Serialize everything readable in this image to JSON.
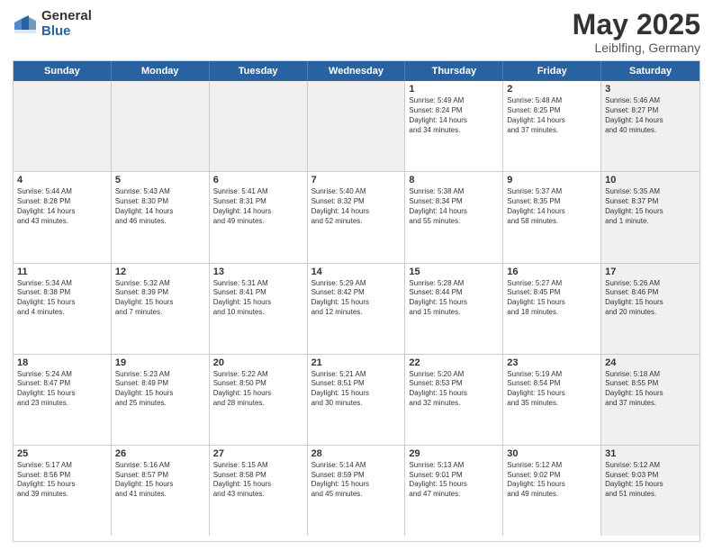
{
  "header": {
    "logo_general": "General",
    "logo_blue": "Blue",
    "title": "May 2025",
    "location": "Leiblfing, Germany"
  },
  "days": [
    "Sunday",
    "Monday",
    "Tuesday",
    "Wednesday",
    "Thursday",
    "Friday",
    "Saturday"
  ],
  "weeks": [
    [
      {
        "day": "",
        "info": "",
        "shaded": true
      },
      {
        "day": "",
        "info": "",
        "shaded": true
      },
      {
        "day": "",
        "info": "",
        "shaded": true
      },
      {
        "day": "",
        "info": "",
        "shaded": true
      },
      {
        "day": "1",
        "info": "Sunrise: 5:49 AM\nSunset: 8:24 PM\nDaylight: 14 hours\nand 34 minutes.",
        "shaded": false
      },
      {
        "day": "2",
        "info": "Sunrise: 5:48 AM\nSunset: 8:25 PM\nDaylight: 14 hours\nand 37 minutes.",
        "shaded": false
      },
      {
        "day": "3",
        "info": "Sunrise: 5:46 AM\nSunset: 8:27 PM\nDaylight: 14 hours\nand 40 minutes.",
        "shaded": true
      }
    ],
    [
      {
        "day": "4",
        "info": "Sunrise: 5:44 AM\nSunset: 8:28 PM\nDaylight: 14 hours\nand 43 minutes.",
        "shaded": false
      },
      {
        "day": "5",
        "info": "Sunrise: 5:43 AM\nSunset: 8:30 PM\nDaylight: 14 hours\nand 46 minutes.",
        "shaded": false
      },
      {
        "day": "6",
        "info": "Sunrise: 5:41 AM\nSunset: 8:31 PM\nDaylight: 14 hours\nand 49 minutes.",
        "shaded": false
      },
      {
        "day": "7",
        "info": "Sunrise: 5:40 AM\nSunset: 8:32 PM\nDaylight: 14 hours\nand 52 minutes.",
        "shaded": false
      },
      {
        "day": "8",
        "info": "Sunrise: 5:38 AM\nSunset: 8:34 PM\nDaylight: 14 hours\nand 55 minutes.",
        "shaded": false
      },
      {
        "day": "9",
        "info": "Sunrise: 5:37 AM\nSunset: 8:35 PM\nDaylight: 14 hours\nand 58 minutes.",
        "shaded": false
      },
      {
        "day": "10",
        "info": "Sunrise: 5:35 AM\nSunset: 8:37 PM\nDaylight: 15 hours\nand 1 minute.",
        "shaded": true
      }
    ],
    [
      {
        "day": "11",
        "info": "Sunrise: 5:34 AM\nSunset: 8:38 PM\nDaylight: 15 hours\nand 4 minutes.",
        "shaded": false
      },
      {
        "day": "12",
        "info": "Sunrise: 5:32 AM\nSunset: 8:39 PM\nDaylight: 15 hours\nand 7 minutes.",
        "shaded": false
      },
      {
        "day": "13",
        "info": "Sunrise: 5:31 AM\nSunset: 8:41 PM\nDaylight: 15 hours\nand 10 minutes.",
        "shaded": false
      },
      {
        "day": "14",
        "info": "Sunrise: 5:29 AM\nSunset: 8:42 PM\nDaylight: 15 hours\nand 12 minutes.",
        "shaded": false
      },
      {
        "day": "15",
        "info": "Sunrise: 5:28 AM\nSunset: 8:44 PM\nDaylight: 15 hours\nand 15 minutes.",
        "shaded": false
      },
      {
        "day": "16",
        "info": "Sunrise: 5:27 AM\nSunset: 8:45 PM\nDaylight: 15 hours\nand 18 minutes.",
        "shaded": false
      },
      {
        "day": "17",
        "info": "Sunrise: 5:26 AM\nSunset: 8:46 PM\nDaylight: 15 hours\nand 20 minutes.",
        "shaded": true
      }
    ],
    [
      {
        "day": "18",
        "info": "Sunrise: 5:24 AM\nSunset: 8:47 PM\nDaylight: 15 hours\nand 23 minutes.",
        "shaded": false
      },
      {
        "day": "19",
        "info": "Sunrise: 5:23 AM\nSunset: 8:49 PM\nDaylight: 15 hours\nand 25 minutes.",
        "shaded": false
      },
      {
        "day": "20",
        "info": "Sunrise: 5:22 AM\nSunset: 8:50 PM\nDaylight: 15 hours\nand 28 minutes.",
        "shaded": false
      },
      {
        "day": "21",
        "info": "Sunrise: 5:21 AM\nSunset: 8:51 PM\nDaylight: 15 hours\nand 30 minutes.",
        "shaded": false
      },
      {
        "day": "22",
        "info": "Sunrise: 5:20 AM\nSunset: 8:53 PM\nDaylight: 15 hours\nand 32 minutes.",
        "shaded": false
      },
      {
        "day": "23",
        "info": "Sunrise: 5:19 AM\nSunset: 8:54 PM\nDaylight: 15 hours\nand 35 minutes.",
        "shaded": false
      },
      {
        "day": "24",
        "info": "Sunrise: 5:18 AM\nSunset: 8:55 PM\nDaylight: 15 hours\nand 37 minutes.",
        "shaded": true
      }
    ],
    [
      {
        "day": "25",
        "info": "Sunrise: 5:17 AM\nSunset: 8:56 PM\nDaylight: 15 hours\nand 39 minutes.",
        "shaded": false
      },
      {
        "day": "26",
        "info": "Sunrise: 5:16 AM\nSunset: 8:57 PM\nDaylight: 15 hours\nand 41 minutes.",
        "shaded": false
      },
      {
        "day": "27",
        "info": "Sunrise: 5:15 AM\nSunset: 8:58 PM\nDaylight: 15 hours\nand 43 minutes.",
        "shaded": false
      },
      {
        "day": "28",
        "info": "Sunrise: 5:14 AM\nSunset: 8:59 PM\nDaylight: 15 hours\nand 45 minutes.",
        "shaded": false
      },
      {
        "day": "29",
        "info": "Sunrise: 5:13 AM\nSunset: 9:01 PM\nDaylight: 15 hours\nand 47 minutes.",
        "shaded": false
      },
      {
        "day": "30",
        "info": "Sunrise: 5:12 AM\nSunset: 9:02 PM\nDaylight: 15 hours\nand 49 minutes.",
        "shaded": false
      },
      {
        "day": "31",
        "info": "Sunrise: 5:12 AM\nSunset: 9:03 PM\nDaylight: 15 hours\nand 51 minutes.",
        "shaded": true
      }
    ]
  ]
}
